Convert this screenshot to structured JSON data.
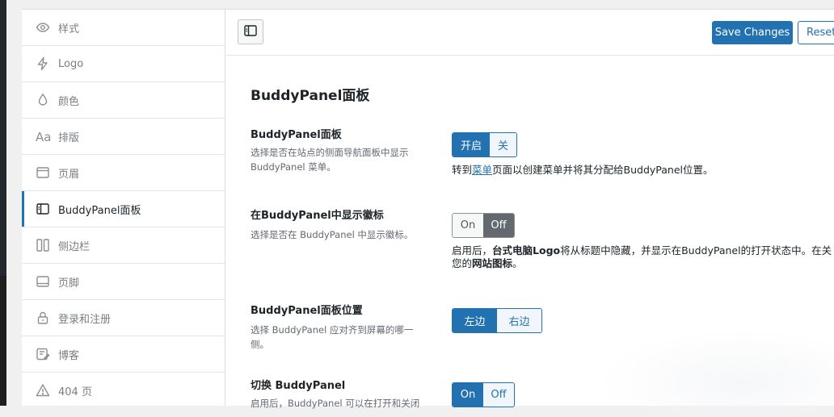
{
  "sidebar": {
    "items": [
      {
        "label": "样式",
        "icon": "eye-icon"
      },
      {
        "label": "Logo",
        "icon": "lightning-icon"
      },
      {
        "label": "颜色",
        "icon": "drop-icon"
      },
      {
        "label": "排版",
        "icon": "typography-icon"
      },
      {
        "label": "页眉",
        "icon": "header-icon"
      },
      {
        "label": "BuddyPanel面板",
        "icon": "panel-icon",
        "active": true
      },
      {
        "label": "侧边栏",
        "icon": "sidebar-icon"
      },
      {
        "label": "页脚",
        "icon": "footer-icon"
      },
      {
        "label": "登录和注册",
        "icon": "lock-icon"
      },
      {
        "label": "博客",
        "icon": "blog-icon"
      },
      {
        "label": "404 页",
        "icon": "warning-icon"
      }
    ],
    "typography_glyph": "Aa"
  },
  "toolbar": {
    "save_label": "Save Changes",
    "reset_label": "Reset"
  },
  "main": {
    "section_title": "BuddyPanel面板",
    "options": [
      {
        "title": "BuddyPanel面板",
        "desc": "选择是否在站点的侧面导航面板中显示 BuddyPanel 菜单。",
        "choices": [
          "开启",
          "关"
        ],
        "selected": "开启",
        "note_pre": "转到",
        "note_link": "菜单",
        "note_post": "页面以创建菜单并将其分配给BuddyPanel位置。"
      },
      {
        "title": "在BuddyPanel中显示徽标",
        "desc": "选择是否在 BuddyPanel 中显示徽标。",
        "choices": [
          "On",
          "Off"
        ],
        "selected": "Off",
        "note_l1_pre": "启用后，",
        "note_l1_bold": "台式电脑Logo",
        "note_l1_post": "将从标题中隐藏，并显示在BuddyPanel的打开状态中。在关",
        "note_l2_pre": "您的",
        "note_l2_bold": "网站图标",
        "note_l2_post": "。"
      },
      {
        "title": "BuddyPanel面板位置",
        "desc": "选择 BuddyPanel 应对齐到屏幕的哪一侧。",
        "choices": [
          "左边",
          "右边"
        ],
        "selected": "左边"
      },
      {
        "title": "切换 BuddyPanel",
        "desc": "启用后，BuddyPanel 可以在打开和关闭",
        "choices": [
          "On",
          "Off"
        ],
        "selected": "On"
      }
    ]
  },
  "colors": {
    "accent": "#2271b1",
    "toggle_off": "#646970",
    "sidebar_active_bar": "#2271b1"
  }
}
